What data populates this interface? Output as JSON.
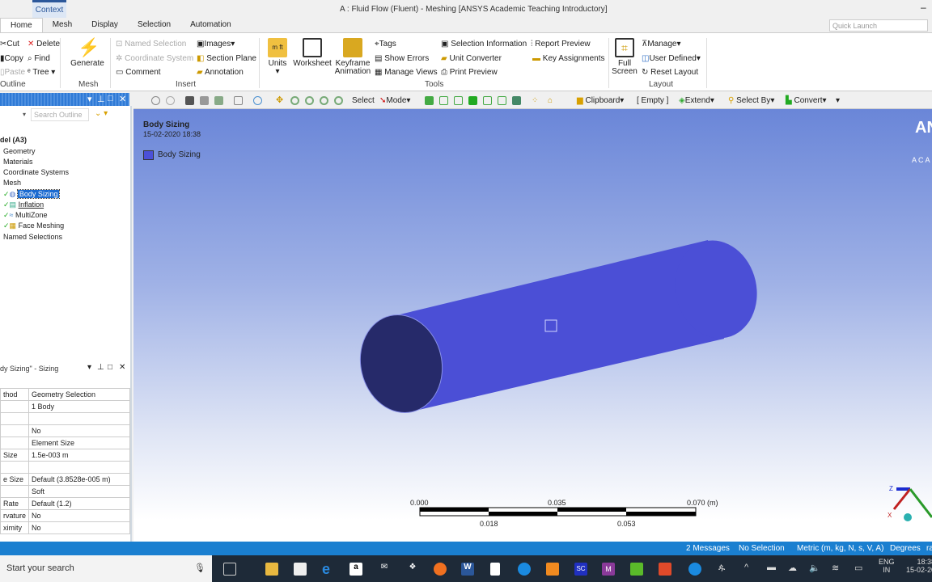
{
  "window": {
    "context_tab": "Context",
    "title": "A : Fluid Flow (Fluent) - Meshing [ANSYS Academic Teaching Introductory]",
    "quick_launch_placeholder": "Quick Launch"
  },
  "tabs": [
    "Home",
    "Mesh",
    "Display",
    "Selection",
    "Automation"
  ],
  "ribbon": {
    "outline": {
      "cut": "Cut",
      "copy": "Copy",
      "paste": "Paste",
      "delete": "Delete",
      "find": "Find",
      "tree": "Tree",
      "group": "Outline"
    },
    "mesh": {
      "generate": "Generate",
      "group": "Mesh"
    },
    "insert": {
      "named_selection": "Named Selection",
      "coordinate_system": "Coordinate System",
      "comment": "Comment",
      "images": "Images",
      "section_plane": "Section Plane",
      "annotation": "Annotation",
      "group": "Insert"
    },
    "tools": {
      "units": "Units",
      "worksheet": "Worksheet",
      "keyframe": "Keyframe Animation",
      "tags": "Tags",
      "show_errors": "Show Errors",
      "manage_views": "Manage Views",
      "selection_information": "Selection Information",
      "unit_converter": "Unit Converter",
      "print_preview": "Print Preview",
      "report_preview": "Report Preview",
      "key_assignments": "Key Assignments",
      "group": "Tools"
    },
    "layout": {
      "full_screen": "Full Screen",
      "manage": "Manage",
      "user_defined": "User Defined",
      "reset_layout": "Reset Layout",
      "group": "Layout"
    }
  },
  "viewport_toolbar": {
    "select": "Select",
    "mode": "Mode",
    "clipboard": "Clipboard",
    "empty": "[ Empty ]",
    "extend": "Extend",
    "select_by": "Select By",
    "convert": "Convert"
  },
  "outline": {
    "search_placeholder": "Search Outline",
    "tree": [
      {
        "label": "del (A3)"
      },
      {
        "label": "Geometry"
      },
      {
        "label": "Materials"
      },
      {
        "label": "Coordinate Systems"
      },
      {
        "label": "Mesh"
      },
      {
        "label": "Body Sizing",
        "selected": true
      },
      {
        "label": "Inflation"
      },
      {
        "label": "MultiZone"
      },
      {
        "label": "Face Meshing"
      },
      {
        "label": "Named Selections"
      }
    ]
  },
  "details": {
    "title": "dy Sizing\" - Sizing",
    "rows": [
      [
        "thod",
        "Geometry Selection"
      ],
      [
        "",
        "1 Body"
      ],
      [
        "",
        ""
      ],
      [
        "",
        "No"
      ],
      [
        "",
        "Element Size"
      ],
      [
        "Size",
        "1.5e-003 m"
      ],
      [
        "",
        ""
      ],
      [
        "e Size",
        "Default (3.8528e-005 m)"
      ],
      [
        "",
        "Soft"
      ],
      [
        "Rate",
        "Default (1.2)"
      ],
      [
        "rvature",
        "No"
      ],
      [
        "ximity",
        "No"
      ]
    ]
  },
  "viewport": {
    "object_title": "Body Sizing",
    "timestamp": "15-02-2020 18:38",
    "legend": "Body Sizing",
    "legend_color": "#4b50d8",
    "logo": "AN",
    "logo_sub": "ACA",
    "scale": {
      "top": [
        "0.000",
        "0.035",
        "0.070 (m)"
      ],
      "bottom": [
        "0.018",
        "0.053"
      ]
    },
    "axis_labels": [
      "Z",
      "X"
    ]
  },
  "status": {
    "messages": "2 Messages",
    "selection": "No Selection",
    "units": "Metric (m, kg, N, s, V, A)",
    "angle": "Degrees",
    "extra": "ra"
  },
  "taskbar": {
    "search": "Start your search",
    "lang": "ENG",
    "region": "IN",
    "time": "18:38",
    "date": "15-02-20"
  }
}
